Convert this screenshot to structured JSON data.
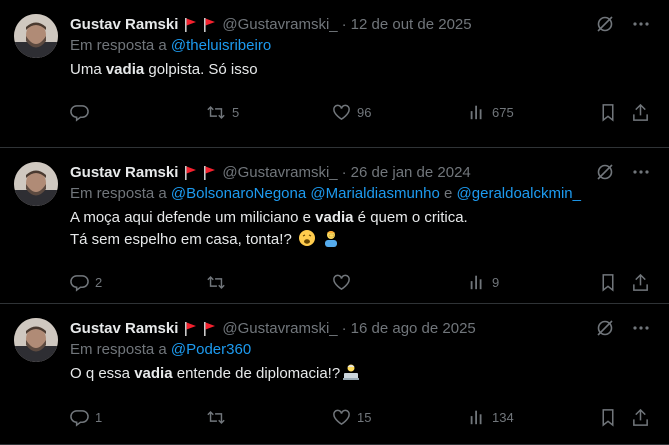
{
  "tweets": [
    {
      "name": "Gustav Ramski",
      "handle": "@Gustavramski_",
      "dot": "·",
      "date": "12 de out de 2025",
      "reply_prefix": "Em resposta a",
      "mentions": [
        "@theluisribeiro"
      ],
      "line1": [
        "Uma ",
        "vadia",
        " golpista. Só isso"
      ],
      "counts": {
        "reply": "",
        "retweet": "5",
        "like": "96",
        "views": "675"
      }
    },
    {
      "name": "Gustav Ramski",
      "handle": "@Gustavramski_",
      "dot": "·",
      "date": "26 de jan de 2024",
      "reply_prefix": "Em resposta a",
      "mentions": [
        "@BolsonaroNegona",
        "@Marialdiasmunho",
        "e",
        "@geraldoalckmin_"
      ],
      "line1": [
        "A moça aqui defende um miliciano e ",
        "vadia",
        " é quem o critica."
      ],
      "line2": "Tá sem espelho em casa, tonta!?",
      "counts": {
        "reply": "2",
        "retweet": "",
        "like": "",
        "views": "9"
      }
    },
    {
      "name": "Gustav Ramski",
      "handle": "@Gustavramski_",
      "dot": "·",
      "date": "16 de ago de 2025",
      "reply_prefix": "Em resposta a",
      "mentions": [
        "@Poder360"
      ],
      "line1": [
        "O q essa ",
        "vadia",
        " entende de diplomacia!?"
      ],
      "counts": {
        "reply": "1",
        "retweet": "",
        "like": "15",
        "views": "134"
      }
    }
  ],
  "colors": {
    "bg": "#000000",
    "text": "#e7e9ea",
    "muted": "#71767b",
    "link": "#1d9bf0",
    "divider": "#2f3336",
    "flag": "#f4212e"
  },
  "icons": [
    "grok-icon",
    "more-icon",
    "reply-icon",
    "retweet-icon",
    "like-icon",
    "views-icon",
    "bookmark-icon",
    "share-icon",
    "red-flag-icon"
  ]
}
